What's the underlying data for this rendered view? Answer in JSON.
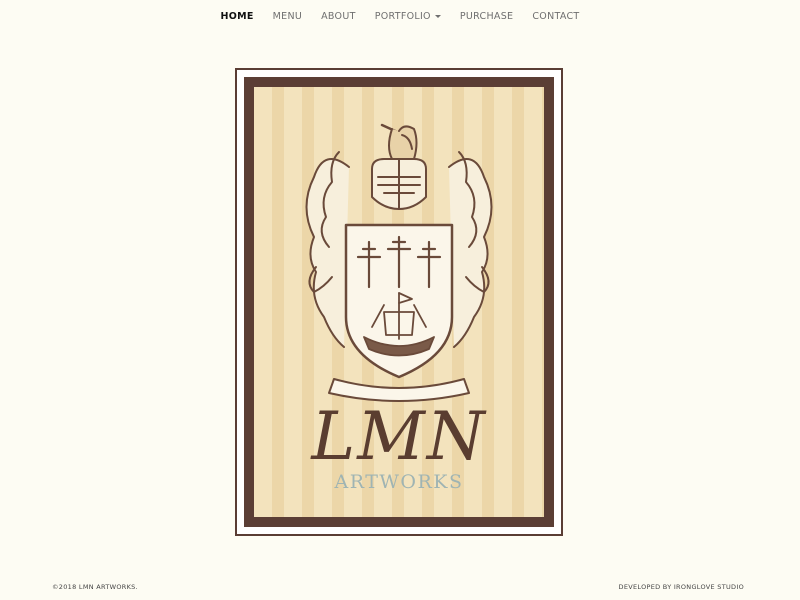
{
  "nav": {
    "items": [
      {
        "label": "HOME",
        "active": true
      },
      {
        "label": "MENU"
      },
      {
        "label": "ABOUT"
      },
      {
        "label": "PORTFOLIO",
        "dropdown": true
      },
      {
        "label": "PURCHASE"
      },
      {
        "label": "CONTACT"
      }
    ]
  },
  "hero": {
    "logo_text": "LMN",
    "subtitle": "ARTWORKS",
    "icon": "coat-of-arms-crest",
    "colors": {
      "frame": "#5b3e35",
      "paper_light": "#f3e3bd",
      "paper_dark": "#ecd6a8",
      "ink": "#6a4a3a",
      "subtitle": "#9fb4b3"
    }
  },
  "footer": {
    "copyright": "©2018 LMN ARTWORKS.",
    "credit": "DEVELOPED BY IRONGLOVE STUDIO"
  }
}
